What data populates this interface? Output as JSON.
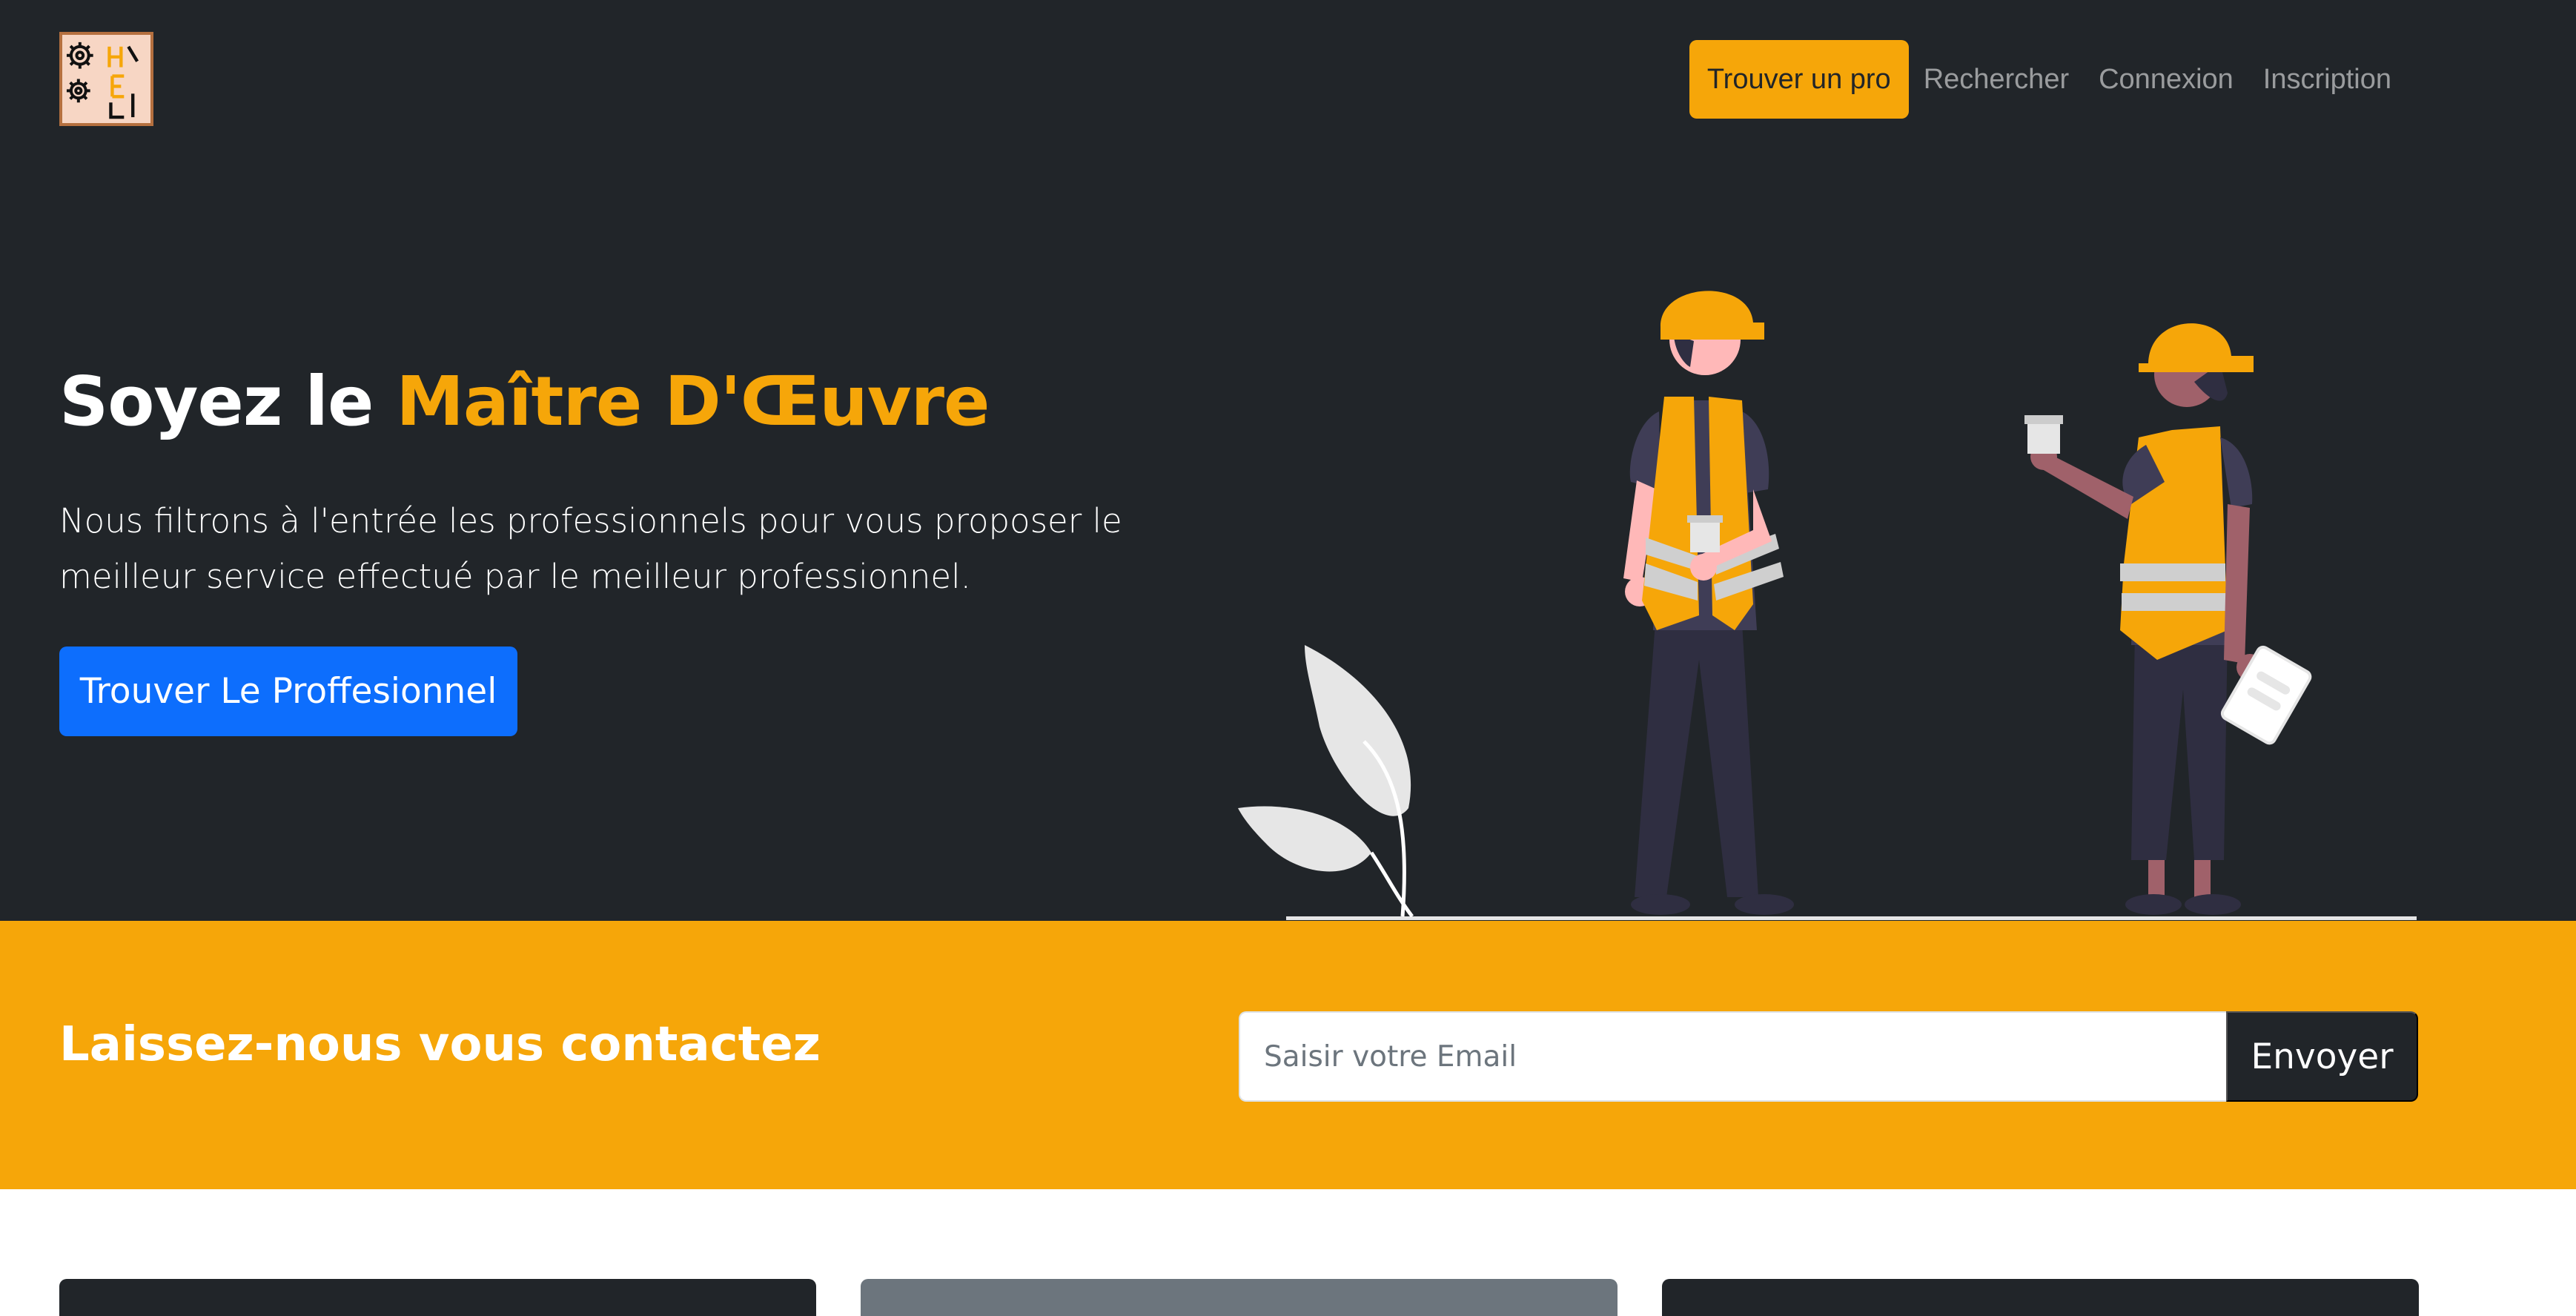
{
  "navbar": {
    "logo_icon": "gear-logo-icon",
    "items": [
      {
        "label": "Trouver un pro",
        "active": true
      },
      {
        "label": "Rechercher",
        "active": false
      },
      {
        "label": "Connexion",
        "active": false
      },
      {
        "label": "Inscription",
        "active": false
      }
    ]
  },
  "hero": {
    "title_prefix": "Soyez le",
    "title_accent": "Maître D'Œuvre",
    "lead": "Nous filtrons à l'entrée les professionnels pour vous proposer le meilleur service effectué par le meilleur professionnel.",
    "cta_label": "Trouver Le Proffesionnel",
    "illustration_icon": "construction-workers-illustration"
  },
  "contact": {
    "title": "Laissez-nous vous contactez",
    "email_placeholder": "Saisir votre Email",
    "email_value": "",
    "submit_label": "Envoyer"
  },
  "colors": {
    "dark": "#212529",
    "accent": "#f6a609",
    "primary": "#0d6efd",
    "muted": "#6c757d"
  }
}
